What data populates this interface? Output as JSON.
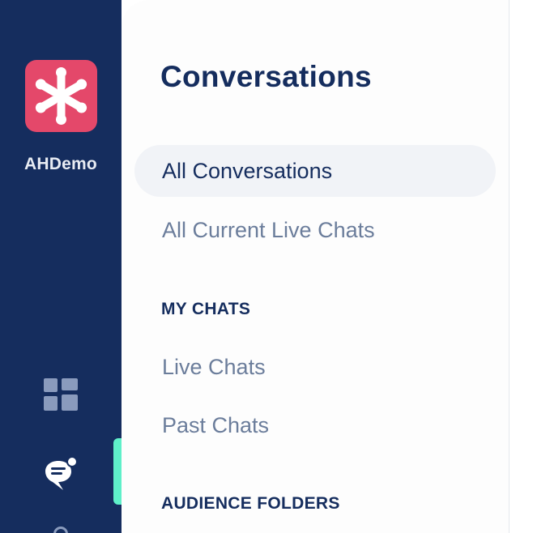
{
  "workspace": {
    "name": "AHDemo",
    "logo_icon": "asterisk-logo-icon",
    "logo_color": "#e4486a"
  },
  "rail": {
    "background": "#152d5e",
    "accent": "#5ff0c9",
    "items": [
      {
        "icon": "dashboard-icon"
      },
      {
        "icon": "conversations-icon",
        "active": true
      }
    ]
  },
  "panel": {
    "title": "Conversations",
    "items": [
      {
        "label": "All Conversations",
        "active": true
      },
      {
        "label": "All Current Live Chats",
        "active": false
      }
    ],
    "sections": [
      {
        "heading": "MY CHATS",
        "items": [
          {
            "label": "Live Chats"
          },
          {
            "label": "Past Chats"
          }
        ]
      },
      {
        "heading": "AUDIENCE FOLDERS",
        "items": []
      }
    ]
  }
}
